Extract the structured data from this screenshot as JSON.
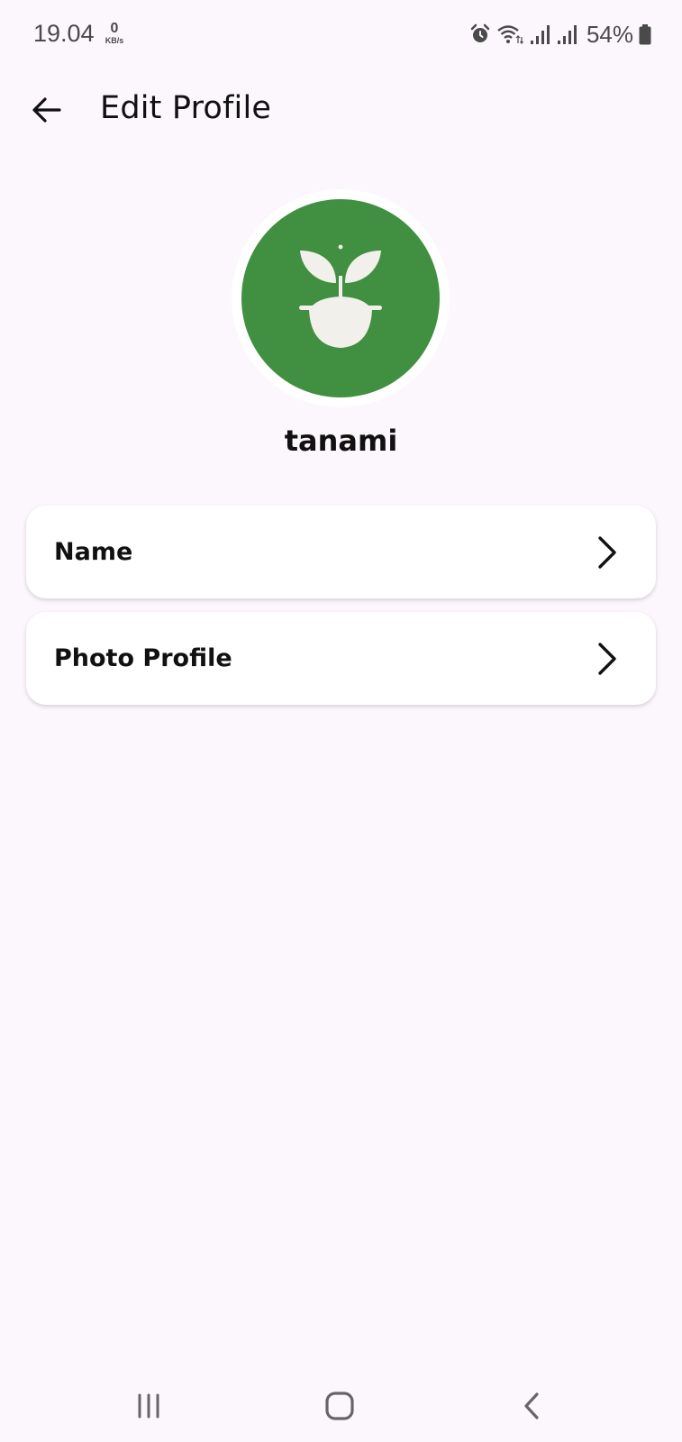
{
  "status_bar": {
    "time": "19.04",
    "net_speed_value": "0",
    "net_speed_unit": "KB/s",
    "battery_percent": "54%",
    "icons": [
      "alarm-icon",
      "wifi-icon",
      "signal-icon",
      "signal-icon",
      "battery-icon"
    ]
  },
  "app_bar": {
    "title": "Edit Profile",
    "back_icon": "arrow-left-icon"
  },
  "profile": {
    "username": "tanami",
    "avatar_icon": "sprout-pot-icon",
    "avatar_color": "#418f40"
  },
  "menu": {
    "items": [
      {
        "label": "Name",
        "icon": "chevron-right-icon"
      },
      {
        "label": "Photo Profile",
        "icon": "chevron-right-icon"
      }
    ]
  },
  "nav_bar": {
    "icons": [
      "recent-apps-icon",
      "home-icon",
      "back-icon"
    ]
  },
  "colors": {
    "background": "#fcf7fc",
    "card": "#ffffff",
    "accent": "#418f40"
  }
}
